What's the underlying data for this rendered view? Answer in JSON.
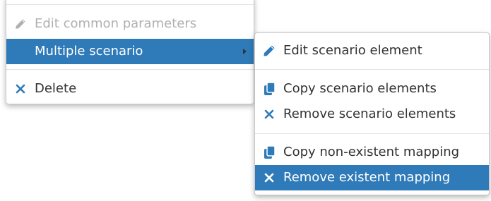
{
  "primary_menu": {
    "items": [
      {
        "label": "Edit common parameters",
        "icon": "pencil-icon",
        "state": "disabled"
      },
      {
        "label": "Multiple scenario",
        "state": "active",
        "has_submenu": true
      },
      {
        "label": "Delete",
        "icon": "close-icon"
      }
    ]
  },
  "submenu": {
    "items": [
      {
        "label": "Edit scenario element",
        "icon": "pencil-icon"
      },
      {
        "label": "Copy scenario elements",
        "icon": "copy-icon"
      },
      {
        "label": "Remove scenario elements",
        "icon": "close-icon"
      },
      {
        "label": "Copy non-existent mapping",
        "icon": "copy-icon"
      },
      {
        "label": "Remove existent mapping",
        "icon": "close-icon",
        "state": "active"
      }
    ]
  },
  "colors": {
    "active_bg": "#2f7ab8",
    "icon_blue": "#2f7ab8",
    "text": "#333333",
    "disabled_text": "#b0b0b0"
  }
}
